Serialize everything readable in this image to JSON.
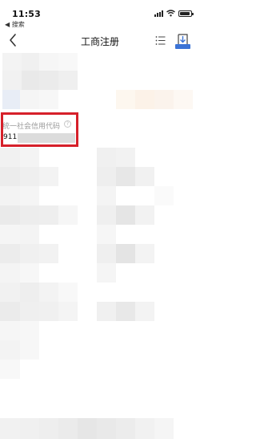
{
  "status_bar": {
    "time": "11:53",
    "back_app": "◀ 搜索"
  },
  "nav": {
    "title": "工商注册",
    "back_icon": "chevron-left-icon",
    "list_icon": "list-icon",
    "download_icon": "download-icon"
  },
  "field": {
    "label": "统一社会信用代码",
    "help_glyph": "?",
    "value_prefix": "9111"
  },
  "colors": {
    "highlight": "#d6202a",
    "badge": "#3b73d6"
  }
}
